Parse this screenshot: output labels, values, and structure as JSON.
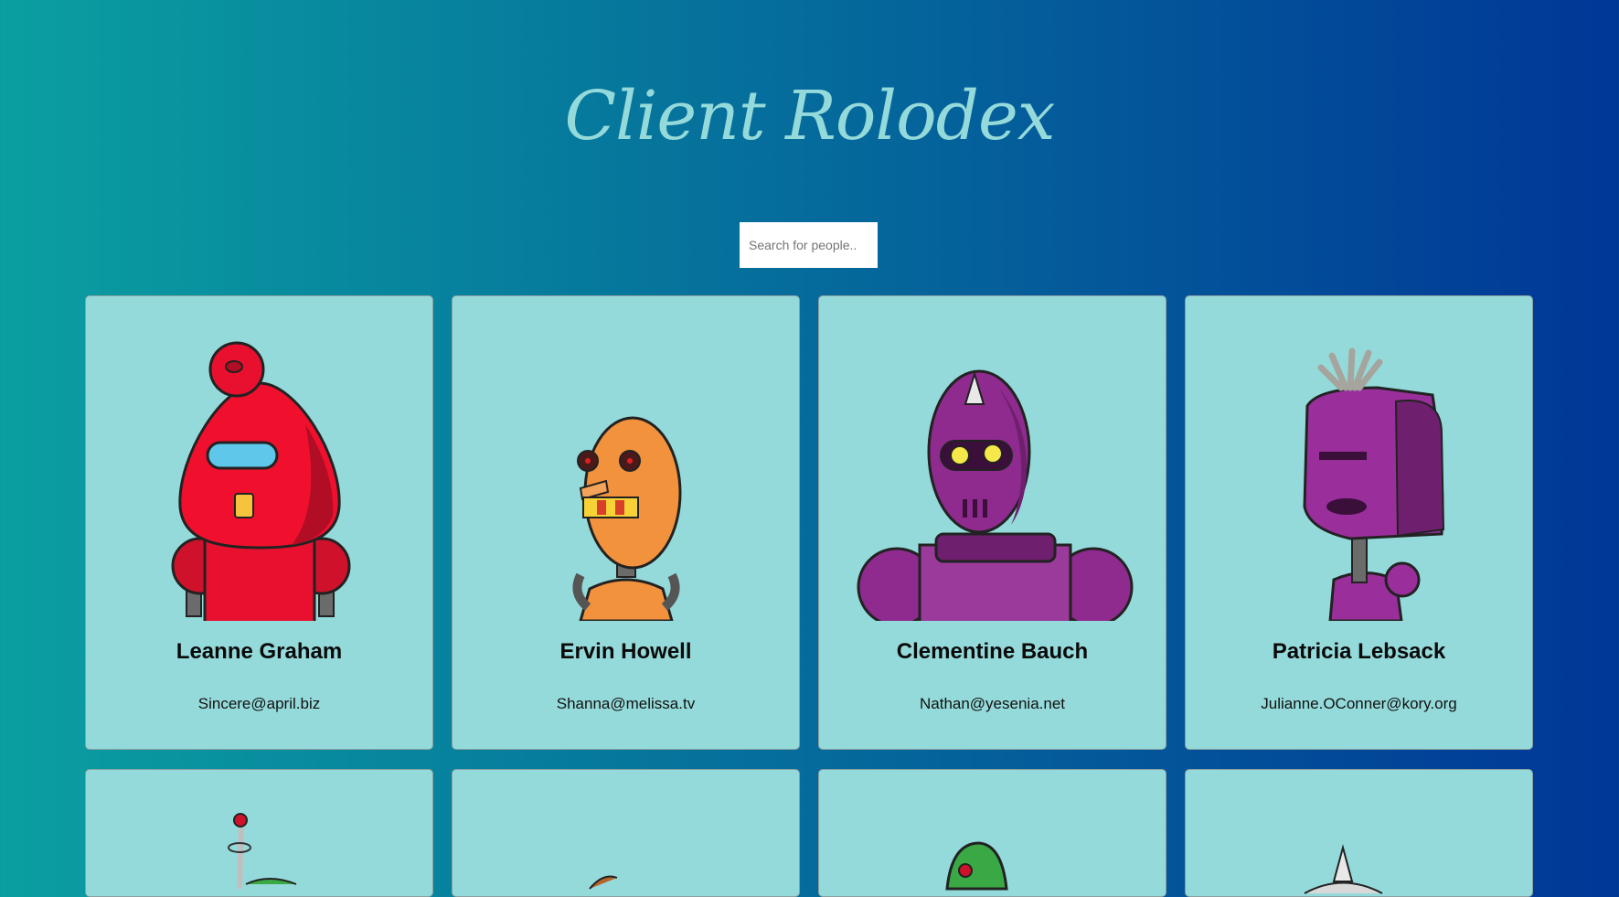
{
  "title": "Client Rolodex",
  "search": {
    "placeholder": "Search for people.."
  },
  "monsters": [
    {
      "name": "Leanne Graham",
      "email": "Sincere@april.biz",
      "robot_icon": "red-robot-icon",
      "color": "#e8102e"
    },
    {
      "name": "Ervin Howell",
      "email": "Shanna@melissa.tv",
      "robot_icon": "orange-robot-icon",
      "color": "#f2923c"
    },
    {
      "name": "Clementine Bauch",
      "email": "Nathan@yesenia.net",
      "robot_icon": "purple-robot-icon",
      "color": "#8f2a8e"
    },
    {
      "name": "Patricia Lebsack",
      "email": "Julianne.OConner@kory.org",
      "robot_icon": "purple-robot-icon",
      "color": "#9a2f9c"
    }
  ],
  "colors": {
    "background_start": "#0a9fa0",
    "background_end": "#003797",
    "card": "#95dada",
    "title": "#95dada"
  }
}
